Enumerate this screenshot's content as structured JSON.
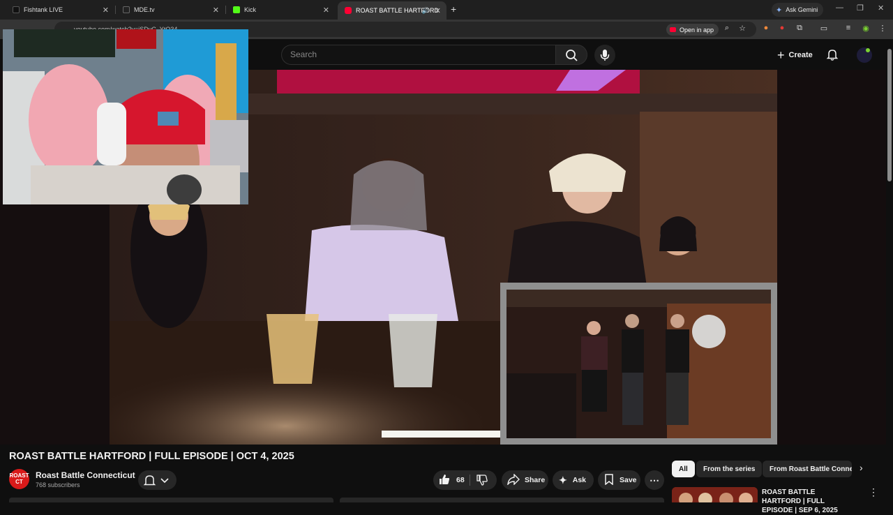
{
  "browser": {
    "tabs": [
      {
        "title": "Fishtank LIVE",
        "active": false
      },
      {
        "title": "MDE.tv",
        "active": false
      },
      {
        "title": "Kick",
        "active": false
      },
      {
        "title": "ROAST BATTLE HARTFORD",
        "active": true
      }
    ],
    "new_tab": "+",
    "ask_gemini": "Ask Gemini",
    "url": "youtube.com/watch?v=iSDvC_YtO34",
    "open_in_app": "Open in app"
  },
  "youtube": {
    "search_placeholder": "Search",
    "create_label": "Create"
  },
  "video": {
    "title": "ROAST BATTLE HARTFORD | FULL EPISODE | OCT 4, 2025",
    "channel_name": "Roast Battle Connecticut",
    "channel_avatar_text": "ROAST CT",
    "subscribers": "768 subscribers",
    "like_count": "68",
    "share_label": "Share",
    "ask_label": "Ask",
    "save_label": "Save"
  },
  "chips": {
    "all": "All",
    "from_series": "From the series",
    "from_channel": "From Roast Battle Connecticut"
  },
  "recommendation": {
    "title": "ROAST BATTLE HARTFORD | FULL EPISODE | SEP 6, 2025"
  },
  "colors": {
    "youtube_red": "#ff0033",
    "background": "#0f0f0f",
    "surface": "#272727",
    "bell_dot": "#7bd232"
  }
}
